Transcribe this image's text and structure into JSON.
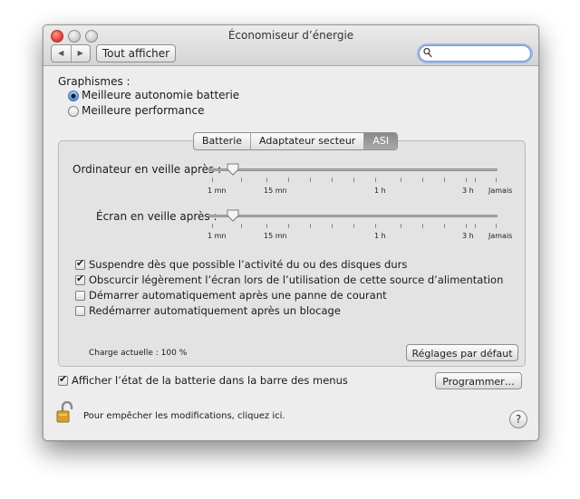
{
  "window": {
    "title": "Économiseur d’énergie"
  },
  "toolbar": {
    "back_label": "◀",
    "forward_label": "▶",
    "show_all_label": "Tout afficher"
  },
  "search": {
    "value": "",
    "placeholder": ""
  },
  "graphics": {
    "label": "Graphismes :",
    "options": [
      {
        "label": "Meilleure autonomie batterie",
        "selected": true
      },
      {
        "label": "Meilleure performance",
        "selected": false
      }
    ]
  },
  "tabs": [
    {
      "label": "Batterie",
      "active": false
    },
    {
      "label": "Adaptateur secteur",
      "active": false
    },
    {
      "label": "ASI",
      "active": true
    }
  ],
  "sliders": {
    "computer": {
      "label": "Ordinateur en veille après :",
      "value": "1 mn"
    },
    "display": {
      "label": "Écran en veille après :",
      "value": "1 mn"
    },
    "tick_labels": [
      "1 mn",
      "15 mn",
      "1 h",
      "3 h",
      "Jamais"
    ]
  },
  "options": [
    {
      "label": "Suspendre dès que possible l’activité du ou des disques durs",
      "checked": true
    },
    {
      "label": "Obscurcir légèrement l’écran lors de l’utilisation de cette source d’alimentation",
      "checked": true
    },
    {
      "label": "Démarrer automatiquement après une panne de courant",
      "checked": false
    },
    {
      "label": "Redémarrer automatiquement après un blocage",
      "checked": false
    }
  ],
  "charge": {
    "label": "Charge actuelle : 100 %"
  },
  "defaults_button": "Réglages par défaut",
  "menu_bar_option": {
    "label": "Afficher l’état de la batterie dans la barre des menus",
    "checked": true
  },
  "schedule_button": "Programmer…",
  "lock": {
    "text": "Pour empêcher les modifications, cliquez ici."
  },
  "help_label": "?",
  "colors": {
    "accent": "#4d8de0",
    "active_tab": "#9a9a9a",
    "close": "#e0443a"
  }
}
